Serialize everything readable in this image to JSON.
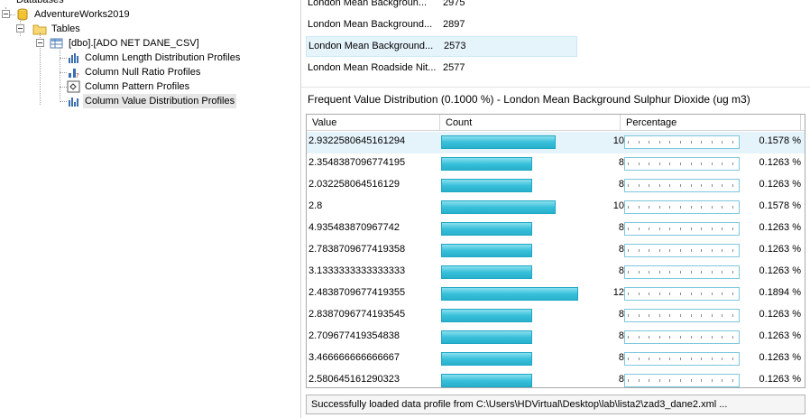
{
  "tree": {
    "root_label": "Databases",
    "database": "AdventureWorks2019",
    "tables_label": "Tables",
    "table": "[dbo].[ADO NET DANE_CSV]",
    "profiles": [
      {
        "label": "Column Length Distribution Profiles",
        "icon": "length-distribution-icon"
      },
      {
        "label": "Column Null Ratio Profiles",
        "icon": "null-ratio-icon"
      },
      {
        "label": "Column Pattern Profiles",
        "icon": "pattern-icon"
      },
      {
        "label": "Column Value Distribution Profiles",
        "icon": "value-distribution-icon",
        "selected": true
      }
    ]
  },
  "top_list": {
    "rows": [
      {
        "column": "London Mean Backgroun...",
        "value": "2975"
      },
      {
        "column": "London Mean Background...",
        "value": "2897"
      },
      {
        "column": "London Mean Background...",
        "value": "2573",
        "selected": true
      },
      {
        "column": "London Mean Roadside Nit...",
        "value": "2577"
      }
    ]
  },
  "frequent": {
    "title": "Frequent Value Distribution (0.1000 %) - London Mean Background Sulphur Dioxide (ug m3)",
    "headers": {
      "value": "Value",
      "count": "Count",
      "percentage": "Percentage"
    },
    "max_count": 12,
    "rows": [
      {
        "value": "2.9322580645161294",
        "count": 10,
        "count_text": "10",
        "percentage": "0.1578 %",
        "selected": true
      },
      {
        "value": "2.3548387096774195",
        "count": 8,
        "count_text": "8",
        "percentage": "0.1263 %"
      },
      {
        "value": "2.032258064516129",
        "count": 8,
        "count_text": "8",
        "percentage": "0.1263 %"
      },
      {
        "value": "2.8",
        "count": 10,
        "count_text": "10",
        "percentage": "0.1578 %"
      },
      {
        "value": "4.935483870967742",
        "count": 8,
        "count_text": "8",
        "percentage": "0.1263 %"
      },
      {
        "value": "2.7838709677419358",
        "count": 8,
        "count_text": "8",
        "percentage": "0.1263 %"
      },
      {
        "value": "3.1333333333333333",
        "count": 8,
        "count_text": "8",
        "percentage": "0.1263 %"
      },
      {
        "value": "2.4838709677419355",
        "count": 12,
        "count_text": "12",
        "percentage": "0.1894 %"
      },
      {
        "value": "2.8387096774193545",
        "count": 8,
        "count_text": "8",
        "percentage": "0.1263 %"
      },
      {
        "value": "2.709677419354838",
        "count": 8,
        "count_text": "8",
        "percentage": "0.1263 %"
      },
      {
        "value": "3.466666666666667",
        "count": 8,
        "count_text": "8",
        "percentage": "0.1263 %"
      },
      {
        "value": "2.580645161290323",
        "count": 8,
        "count_text": "8",
        "percentage": "0.1263 %"
      }
    ]
  },
  "status": "Successfully loaded data profile from C:\\Users\\HDVirtual\\Desktop\\lab\\lista2\\zad3_dane2.xml ...",
  "colors": {
    "bar": "#39c0da",
    "selection": "#e5f3fb"
  }
}
